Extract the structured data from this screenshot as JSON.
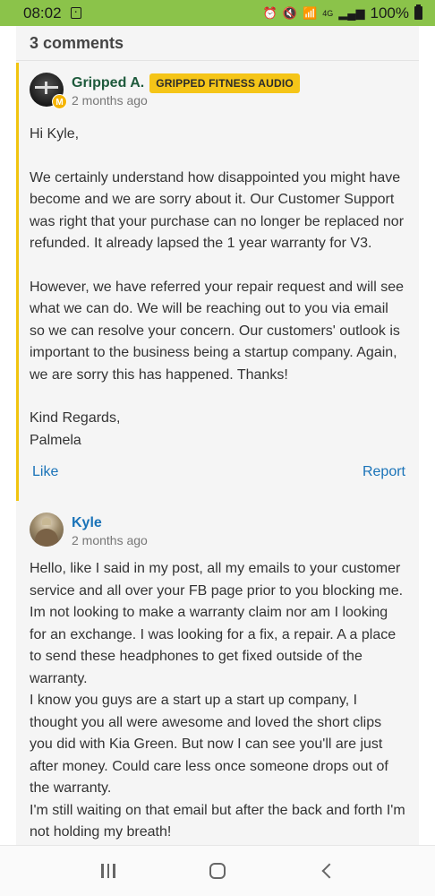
{
  "status_bar": {
    "time": "08:02",
    "notif_icon": "app-notification-icon",
    "network": "4G",
    "battery_percent": "100%"
  },
  "comments": {
    "header": "3 comments",
    "items": [
      {
        "author": "Gripped A.",
        "badge": "GRIPPED FITNESS AUDIO",
        "moderator_badge": "M",
        "time": "2 months ago",
        "paragraphs": [
          "Hi Kyle,",
          "We certainly understand how disappointed you might have become and we are sorry about it. Our Customer Support was right that your purchase can no longer be replaced nor refunded. It already lapsed the 1 year warranty for V3.",
          "However, we have referred your repair request and will see what we can do. We will be reaching out to you via email so we can resolve your concern. Our customers' outlook is important to the business being a startup company. Again, we are sorry this has happened. Thanks!",
          "Kind Regards,\nPalmela"
        ],
        "like_label": "Like",
        "report_label": "Report"
      },
      {
        "author": "Kyle",
        "time": "2 months ago",
        "paragraphs": [
          "Hello, like I said in my post, all my emails to your customer service and all over your FB page prior to you blocking me. Im not looking to make a warranty claim nor am I looking for an exchange. I was looking for a fix, a repair. A a place to send these headphones to get fixed outside of the warranty.",
          "I know you guys are a start up a start up company, I thought you all were awesome and loved the short clips you did with Kia Green. But now I can see you'll are just after money. Could care less once someone drops out of the warranty.",
          "I'm still waiting on that email but after the back and forth I'm not holding my breath!"
        ]
      }
    ]
  },
  "colors": {
    "status_bar": "#8bc34a",
    "accent_link": "#1a73b8",
    "moderator_border": "#f1c40f",
    "badge": "#f5c518"
  }
}
